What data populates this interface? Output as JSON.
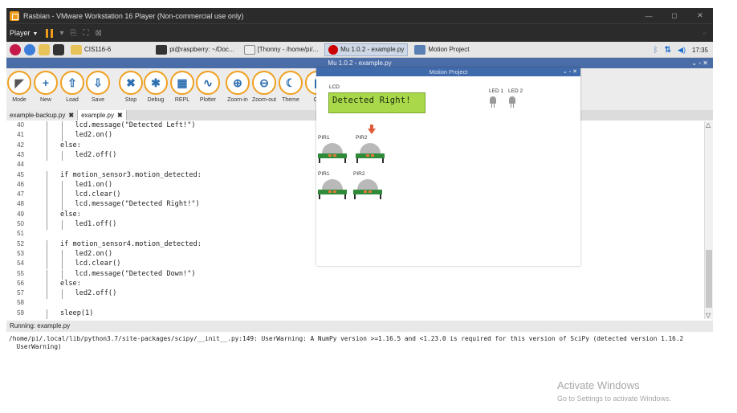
{
  "vm": {
    "title": "Rasbian - VMware Workstation 16 Player (Non-commercial use only)",
    "player_menu": "Player",
    "controls": {
      "minimize": "—",
      "maximize": "◻",
      "close": "✕"
    },
    "toolbar_right": "«"
  },
  "taskbar": {
    "items": [
      {
        "label": "CIS116-6"
      },
      {
        "label": "pi@raspberry: ~/Doc..."
      },
      {
        "label": "[Thonny - /home/pi/..."
      },
      {
        "label": "Mu 1.0.2 - example.py"
      },
      {
        "label": "Motion Project"
      }
    ],
    "clock": "17:35"
  },
  "mu": {
    "title": "Mu 1.0.2 - example.py",
    "title_controls": "⌄ ◦ ✕",
    "toolbar": [
      {
        "label": "Mode",
        "icon": "mode-icon",
        "glyph": "◤"
      },
      {
        "label": "New",
        "icon": "plus-icon",
        "glyph": "+"
      },
      {
        "label": "Load",
        "icon": "upload-icon",
        "glyph": "⇧"
      },
      {
        "label": "Save",
        "icon": "download-icon",
        "glyph": "⇩"
      },
      {
        "label": "Stop",
        "icon": "stop-icon",
        "glyph": "✖"
      },
      {
        "label": "Debug",
        "icon": "bug-icon",
        "glyph": "✱"
      },
      {
        "label": "REPL",
        "icon": "keyboard-icon",
        "glyph": "▦"
      },
      {
        "label": "Plotter",
        "icon": "plotter-icon",
        "glyph": "∿"
      },
      {
        "label": "Zoom-in",
        "icon": "zoom-in-icon",
        "glyph": "⊕"
      },
      {
        "label": "Zoom-out",
        "icon": "zoom-out-icon",
        "glyph": "⊖"
      },
      {
        "label": "Theme",
        "icon": "moon-icon",
        "glyph": "☾"
      },
      {
        "label": "Ch",
        "icon": "check-icon",
        "glyph": "▮"
      }
    ],
    "tabs": [
      {
        "label": "example-backup.py",
        "close": "✖"
      },
      {
        "label": "example.py",
        "close": "✖"
      }
    ],
    "code_lines": [
      {
        "n": "40",
        "indent": 2,
        "text": "lcd.message(\"Detected Left!\")"
      },
      {
        "n": "41",
        "indent": 2,
        "text": "led2.on()"
      },
      {
        "n": "42",
        "indent": 1,
        "text": "else:"
      },
      {
        "n": "43",
        "indent": 2,
        "text": "led2.off()"
      },
      {
        "n": "44",
        "indent": 0,
        "text": ""
      },
      {
        "n": "45",
        "indent": 1,
        "text": "if motion_sensor3.motion_detected:"
      },
      {
        "n": "46",
        "indent": 2,
        "text": "led1.on()"
      },
      {
        "n": "47",
        "indent": 2,
        "text": "lcd.clear()"
      },
      {
        "n": "48",
        "indent": 2,
        "text": "lcd.message(\"Detected Right!\")"
      },
      {
        "n": "49",
        "indent": 1,
        "text": "else:"
      },
      {
        "n": "50",
        "indent": 2,
        "text": "led1.off()"
      },
      {
        "n": "51",
        "indent": 0,
        "text": ""
      },
      {
        "n": "52",
        "indent": 1,
        "text": "if motion_sensor4.motion_detected:"
      },
      {
        "n": "53",
        "indent": 2,
        "text": "led2.on()"
      },
      {
        "n": "54",
        "indent": 2,
        "text": "lcd.clear()"
      },
      {
        "n": "55",
        "indent": 2,
        "text": "lcd.message(\"Detected Down!\")"
      },
      {
        "n": "56",
        "indent": 1,
        "text": "else:"
      },
      {
        "n": "57",
        "indent": 2,
        "text": "led2.off()"
      },
      {
        "n": "58",
        "indent": 0,
        "text": ""
      },
      {
        "n": "59",
        "indent": 1,
        "text": "sleep(1)"
      }
    ],
    "running_label": "Running: example.py",
    "output": "/home/pi/.local/lib/python3.7/site-packages/scipy/__init__.py:149: UserWarning: A NumPy version >=1.16.5 and <1.23.0 is required for this version of SciPy (detected version 1.16.2\n  UserWarning)"
  },
  "motion": {
    "title": "Motion Project",
    "controls": "⌄ ◦ ✕",
    "lcd_label": "LCD",
    "lcd_text": "Detected Right!",
    "led1_label": "LED 1",
    "led2_label": "LED 2",
    "pir_labels": [
      "PIR1",
      "PIR2",
      "PIR1",
      "PIR2"
    ]
  },
  "activate": {
    "title": "Activate Windows",
    "subtitle": "Go to Settings to activate Windows."
  },
  "colors": {
    "accent": "#f0a020",
    "mu_icon": "#2e6fb0",
    "title_bar": "#4a6da7",
    "lcd": "#a9d84a",
    "pir_board": "#2f8a3a"
  }
}
